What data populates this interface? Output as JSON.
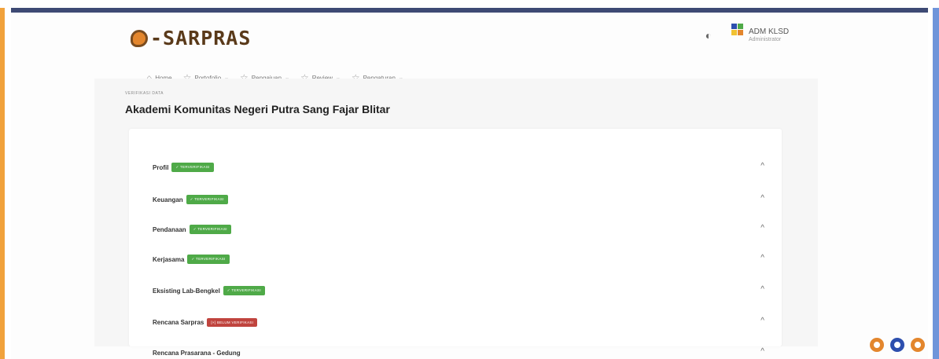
{
  "logo": {
    "prefix": "e",
    "text": "-SARPRAS"
  },
  "header": {
    "theme_icon": "half-moon-icon",
    "user": {
      "name": "ADM KLSD",
      "role": "Administrator"
    }
  },
  "nav": {
    "items": [
      {
        "label": "Home",
        "icon": "home-icon",
        "dropdown": ""
      },
      {
        "label": "Portofolio",
        "icon": "star-icon",
        "dropdown": "⌄"
      },
      {
        "label": "Pengajuan",
        "icon": "star-icon",
        "dropdown": "⌄"
      },
      {
        "label": "Review",
        "icon": "star-icon",
        "dropdown": "⌄"
      },
      {
        "label": "Pengaturan",
        "icon": "star-icon",
        "dropdown": "⌄"
      }
    ]
  },
  "page": {
    "breadcrumb": "VERIFIKASI DATA",
    "title": "Akademi Komunitas Negeri Putra Sang Fajar Blitar"
  },
  "sections": {
    "items": [
      {
        "label": "Profil",
        "status": "✓ TERVERIFIKASI"
      },
      {
        "label": "Keuangan",
        "status": "✓ TERVERIFIKASI"
      },
      {
        "label": "Pendanaan",
        "status": "✓ TERVERIFIKASI"
      },
      {
        "label": "Kerjasama",
        "status": "✓ TERVERIFIKASI"
      },
      {
        "label": "Eksisting Lab-Bengkel",
        "status": "✓ TERVERIFIKASI"
      },
      {
        "label": "Rencana Sarpras",
        "status": "[×] BELUM VERIFIKASI"
      },
      {
        "label": "Rencana Prasarana - Gedung",
        "status": ""
      }
    ],
    "chevron": "^"
  },
  "colors": {
    "verified": "#4faa48",
    "unverified": "#c0443e",
    "accent": "#e3862d",
    "frame": "#3e4a74"
  }
}
